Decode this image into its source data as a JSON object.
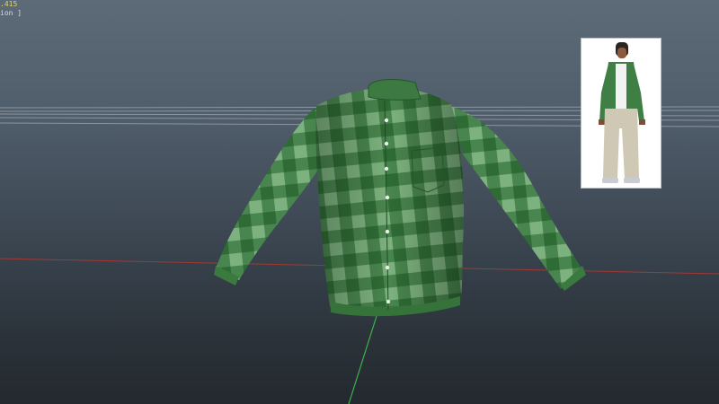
{
  "viewport": {
    "hud": {
      "coordinate": ".415",
      "mode_label": "ion ]"
    },
    "colors": {
      "background_top": "#5d6b79",
      "background_bottom": "#23292f",
      "grid_line": "#9aa4ad",
      "axis_x": "#a03a34",
      "axis_y": "#3fb24a",
      "shirt_base": "#2f6b35",
      "shirt_light": "#8cc08e"
    },
    "model": {
      "name_icon": "plaid-shirt-model",
      "pattern": "green-plaid",
      "buttons": 7
    },
    "thumbnail": {
      "icon": "character-preview-icon"
    }
  }
}
